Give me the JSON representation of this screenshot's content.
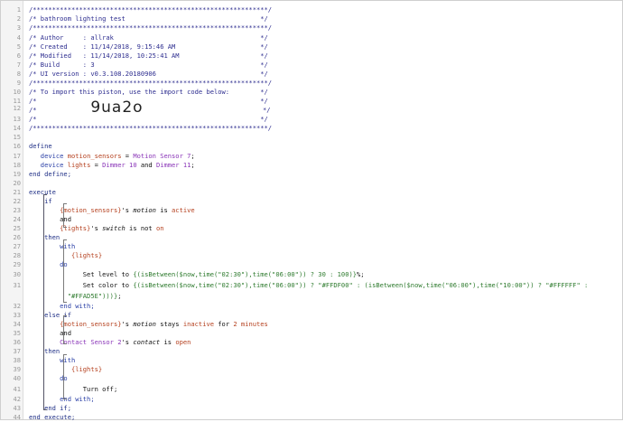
{
  "editor": {
    "lines": [
      {
        "n": "1",
        "parts": [
          {
            "t": "/*************************************************************/",
            "c": "c"
          }
        ]
      },
      {
        "n": "2",
        "parts": [
          {
            "t": "/* bathroom lighting test                                   */",
            "c": "c"
          }
        ]
      },
      {
        "n": "3",
        "parts": [
          {
            "t": "/*************************************************************/",
            "c": "c"
          }
        ]
      },
      {
        "n": "4",
        "parts": [
          {
            "t": "/* Author     : allrak                                      */",
            "c": "c"
          }
        ]
      },
      {
        "n": "5",
        "parts": [
          {
            "t": "/* Created    : 11/14/2018, 9:15:46 AM                      */",
            "c": "c"
          }
        ]
      },
      {
        "n": "6",
        "parts": [
          {
            "t": "/* Modified   : 11/14/2018, 10:25:41 AM                     */",
            "c": "c"
          }
        ]
      },
      {
        "n": "7",
        "parts": [
          {
            "t": "/* Build      : 3                                           */",
            "c": "c"
          }
        ]
      },
      {
        "n": "8",
        "parts": [
          {
            "t": "/* UI version : v0.3.108.20180906                           */",
            "c": "c"
          }
        ]
      },
      {
        "n": "9",
        "parts": [
          {
            "t": "/*************************************************************/",
            "c": "c"
          }
        ]
      },
      {
        "n": "10",
        "parts": [
          {
            "t": "/* To import this piston, use the import code below:        */",
            "c": "c"
          }
        ]
      },
      {
        "n": "11",
        "parts": [
          {
            "t": "/*                                                          */",
            "c": "c"
          }
        ]
      },
      {
        "n": "12",
        "parts": [
          {
            "t": "/*              ",
            "c": "c"
          },
          {
            "t": "9ua2o",
            "c": "big"
          },
          {
            "t": "                               */",
            "c": "c"
          }
        ]
      },
      {
        "n": "13",
        "parts": [
          {
            "t": "/*                                                          */",
            "c": "c"
          }
        ]
      },
      {
        "n": "14",
        "parts": [
          {
            "t": "/*************************************************************/",
            "c": "c"
          }
        ]
      },
      {
        "n": "15",
        "parts": []
      },
      {
        "n": "16",
        "parts": [
          {
            "t": "define",
            "c": "kw"
          }
        ]
      },
      {
        "n": "17",
        "parts": [
          {
            "t": "   device ",
            "c": "blue"
          },
          {
            "t": "motion_sensors",
            "c": "red"
          },
          {
            "t": " = ",
            "c": "black"
          },
          {
            "t": "Motion Sensor 7",
            "c": "purple"
          },
          {
            "t": ";",
            "c": "black"
          }
        ]
      },
      {
        "n": "18",
        "parts": [
          {
            "t": "   device ",
            "c": "blue"
          },
          {
            "t": "lights",
            "c": "red"
          },
          {
            "t": " = ",
            "c": "black"
          },
          {
            "t": "Dimmer 10",
            "c": "purple"
          },
          {
            "t": " and ",
            "c": "black"
          },
          {
            "t": "Dimmer 11",
            "c": "purple"
          },
          {
            "t": ";",
            "c": "black"
          }
        ]
      },
      {
        "n": "19",
        "parts": [
          {
            "t": "end define;",
            "c": "kw"
          }
        ]
      },
      {
        "n": "20",
        "parts": []
      },
      {
        "n": "21",
        "parts": [
          {
            "t": "execute",
            "c": "kw"
          }
        ]
      },
      {
        "n": "22",
        "parts": [
          {
            "t": "    if",
            "c": "kw"
          }
        ]
      },
      {
        "n": "23",
        "parts": [
          {
            "t": "        {motion_sensors}",
            "c": "red"
          },
          {
            "t": "'s ",
            "c": "black"
          },
          {
            "t": "motion",
            "c": "black it"
          },
          {
            "t": " is ",
            "c": "black"
          },
          {
            "t": "active",
            "c": "red"
          }
        ]
      },
      {
        "n": "24",
        "parts": [
          {
            "t": "        and",
            "c": "black"
          }
        ]
      },
      {
        "n": "25",
        "parts": [
          {
            "t": "        {lights}",
            "c": "red"
          },
          {
            "t": "'s ",
            "c": "black"
          },
          {
            "t": "switch",
            "c": "black it"
          },
          {
            "t": " is not ",
            "c": "black"
          },
          {
            "t": "on",
            "c": "red"
          }
        ]
      },
      {
        "n": "26",
        "parts": [
          {
            "t": "    then",
            "c": "kw"
          }
        ]
      },
      {
        "n": "27",
        "parts": [
          {
            "t": "        with",
            "c": "blue"
          }
        ]
      },
      {
        "n": "28",
        "parts": [
          {
            "t": "           {lights}",
            "c": "red"
          }
        ]
      },
      {
        "n": "29",
        "parts": [
          {
            "t": "        do",
            "c": "blue"
          }
        ]
      },
      {
        "n": "30",
        "parts": [
          {
            "t": "              Set level to ",
            "c": "black"
          },
          {
            "t": "{(isBetween($now,time(\"02:30\"),time(\"06:00\")) ? 30 : 100)}",
            "c": "green"
          },
          {
            "t": "%;",
            "c": "black"
          }
        ]
      },
      {
        "n": "31",
        "parts": [
          {
            "t": "              Set color to ",
            "c": "black"
          },
          {
            "t": "{(isBetween($now,time(\"02:30\"),time(\"06:00\")) ? \"#FFDF00\" : (isBetween($now,time(\"06:00\"),time(\"10:00\")) ? \"#FFFFFF\" :",
            "c": "green"
          }
        ]
      },
      {
        "n": "31b",
        "parts": [
          {
            "t": "          \"#FFAD5E\")))}",
            "c": "green"
          },
          {
            "t": ";",
            "c": "black"
          }
        ]
      },
      {
        "n": "32",
        "parts": [
          {
            "t": "        end with;",
            "c": "blue"
          }
        ]
      },
      {
        "n": "33",
        "parts": [
          {
            "t": "    else if",
            "c": "kw"
          }
        ]
      },
      {
        "n": "34",
        "parts": [
          {
            "t": "        {motion_sensors}",
            "c": "red"
          },
          {
            "t": "'s ",
            "c": "black"
          },
          {
            "t": "motion",
            "c": "black it"
          },
          {
            "t": " stays ",
            "c": "black"
          },
          {
            "t": "inactive",
            "c": "red"
          },
          {
            "t": " for ",
            "c": "black"
          },
          {
            "t": "2 minutes",
            "c": "red"
          }
        ]
      },
      {
        "n": "35",
        "parts": [
          {
            "t": "        and",
            "c": "black"
          }
        ]
      },
      {
        "n": "36",
        "parts": [
          {
            "t": "        Contact Sensor 2",
            "c": "purple"
          },
          {
            "t": "'s ",
            "c": "black"
          },
          {
            "t": "contact",
            "c": "black it"
          },
          {
            "t": " is ",
            "c": "black"
          },
          {
            "t": "open",
            "c": "red"
          }
        ]
      },
      {
        "n": "37",
        "parts": [
          {
            "t": "    then",
            "c": "kw"
          }
        ]
      },
      {
        "n": "38",
        "parts": [
          {
            "t": "        with",
            "c": "blue"
          }
        ]
      },
      {
        "n": "39",
        "parts": [
          {
            "t": "           {lights}",
            "c": "red"
          }
        ]
      },
      {
        "n": "40",
        "parts": [
          {
            "t": "        do",
            "c": "blue"
          }
        ]
      },
      {
        "n": "41",
        "parts": [
          {
            "t": "              Turn off;",
            "c": "black"
          }
        ]
      },
      {
        "n": "42",
        "parts": [
          {
            "t": "        end with;",
            "c": "blue"
          }
        ]
      },
      {
        "n": "43",
        "parts": [
          {
            "t": "    end if;",
            "c": "kw"
          }
        ]
      },
      {
        "n": "44",
        "parts": [
          {
            "t": "end execute;",
            "c": "kw"
          }
        ]
      }
    ]
  }
}
